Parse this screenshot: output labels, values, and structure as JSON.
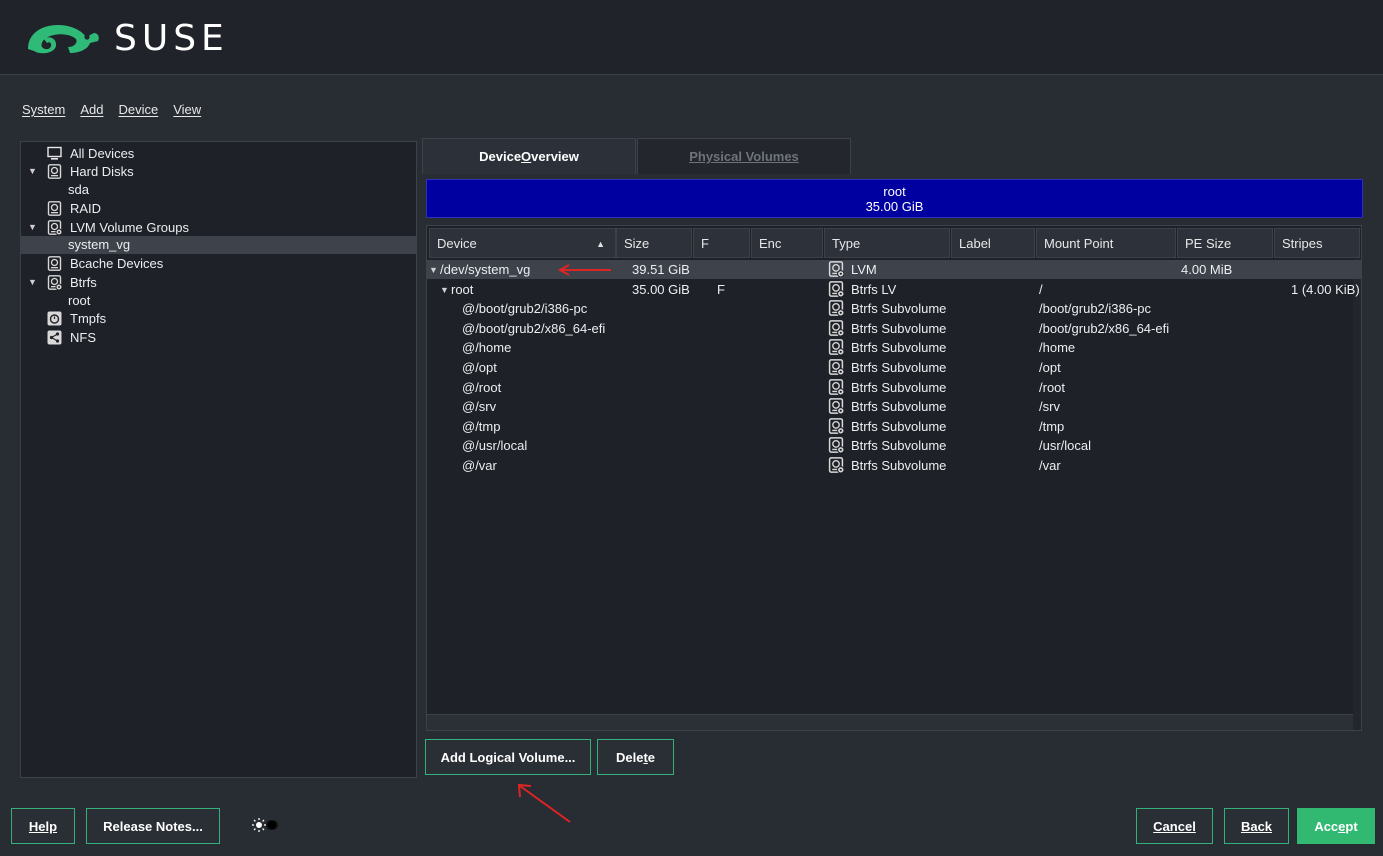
{
  "header": {
    "brand": "SUSE"
  },
  "menu": [
    {
      "label": "System",
      "name": "menu-system"
    },
    {
      "label": "Add",
      "name": "menu-add"
    },
    {
      "label": "Device",
      "name": "menu-device"
    },
    {
      "label": "View",
      "name": "menu-view"
    }
  ],
  "tree": [
    {
      "label": "All Devices",
      "icon": "monitor-icon",
      "level": 0,
      "expander": false
    },
    {
      "label": "Hard Disks",
      "icon": "hard-disk-icon",
      "level": 0,
      "expander": true
    },
    {
      "label": "sda",
      "icon": null,
      "level": 1,
      "expander": false
    },
    {
      "label": "RAID",
      "icon": "raid-icon",
      "level": 0,
      "expander": false
    },
    {
      "label": "LVM Volume Groups",
      "icon": "lvm-icon",
      "level": 0,
      "expander": true
    },
    {
      "label": "system_vg",
      "icon": null,
      "level": 1,
      "expander": false,
      "selected": true
    },
    {
      "label": "Bcache Devices",
      "icon": "bcache-icon",
      "level": 0,
      "expander": false
    },
    {
      "label": "Btrfs",
      "icon": "btrfs-icon",
      "level": 0,
      "expander": true
    },
    {
      "label": "root",
      "icon": null,
      "level": 1,
      "expander": false
    },
    {
      "label": "Tmpfs",
      "icon": "tmpfs-icon",
      "level": 0,
      "expander": false
    },
    {
      "label": "NFS",
      "icon": "nfs-icon",
      "level": 0,
      "expander": false
    }
  ],
  "tabs": {
    "overview": {
      "pre": "Device ",
      "u": "O",
      "post": "verview"
    },
    "physical": {
      "label": "Physical Volumes"
    }
  },
  "summary": {
    "name": "root",
    "size": "35.00 GiB"
  },
  "table": {
    "columns": [
      "Device",
      "Size",
      "F",
      "Enc",
      "Type",
      "Label",
      "Mount Point",
      "PE Size",
      "Stripes"
    ],
    "rows": [
      {
        "device": "/dev/system_vg",
        "indent": 0,
        "expander": true,
        "size": "39.51 GiB",
        "f": "",
        "enc": "",
        "type": "LVM",
        "type_icon": "lvm-icon",
        "label": "",
        "mount": "",
        "pe": "4.00 MiB",
        "stripes": "",
        "selected": true
      },
      {
        "device": "root",
        "indent": 1,
        "expander": true,
        "size": "35.00 GiB",
        "f": "F",
        "enc": "",
        "type": "Btrfs LV",
        "type_icon": "btrfs-lv-icon",
        "label": "",
        "mount": "/",
        "pe": "",
        "stripes": "1 (4.00 KiB)"
      },
      {
        "device": "@/boot/grub2/i386-pc",
        "indent": 2,
        "expander": false,
        "size": "",
        "f": "",
        "enc": "",
        "type": "Btrfs Subvolume",
        "type_icon": "subvolume-icon",
        "label": "",
        "mount": "/boot/grub2/i386-pc",
        "pe": "",
        "stripes": ""
      },
      {
        "device": "@/boot/grub2/x86_64-efi",
        "indent": 2,
        "expander": false,
        "size": "",
        "f": "",
        "enc": "",
        "type": "Btrfs Subvolume",
        "type_icon": "subvolume-icon",
        "label": "",
        "mount": "/boot/grub2/x86_64-efi",
        "pe": "",
        "stripes": ""
      },
      {
        "device": "@/home",
        "indent": 2,
        "expander": false,
        "size": "",
        "f": "",
        "enc": "",
        "type": "Btrfs Subvolume",
        "type_icon": "subvolume-icon",
        "label": "",
        "mount": "/home",
        "pe": "",
        "stripes": ""
      },
      {
        "device": "@/opt",
        "indent": 2,
        "expander": false,
        "size": "",
        "f": "",
        "enc": "",
        "type": "Btrfs Subvolume",
        "type_icon": "subvolume-icon",
        "label": "",
        "mount": "/opt",
        "pe": "",
        "stripes": ""
      },
      {
        "device": "@/root",
        "indent": 2,
        "expander": false,
        "size": "",
        "f": "",
        "enc": "",
        "type": "Btrfs Subvolume",
        "type_icon": "subvolume-icon",
        "label": "",
        "mount": "/root",
        "pe": "",
        "stripes": ""
      },
      {
        "device": "@/srv",
        "indent": 2,
        "expander": false,
        "size": "",
        "f": "",
        "enc": "",
        "type": "Btrfs Subvolume",
        "type_icon": "subvolume-icon",
        "label": "",
        "mount": "/srv",
        "pe": "",
        "stripes": ""
      },
      {
        "device": "@/tmp",
        "indent": 2,
        "expander": false,
        "size": "",
        "f": "",
        "enc": "",
        "type": "Btrfs Subvolume",
        "type_icon": "subvolume-icon",
        "label": "",
        "mount": "/tmp",
        "pe": "",
        "stripes": ""
      },
      {
        "device": "@/usr/local",
        "indent": 2,
        "expander": false,
        "size": "",
        "f": "",
        "enc": "",
        "type": "Btrfs Subvolume",
        "type_icon": "subvolume-icon",
        "label": "",
        "mount": "/usr/local",
        "pe": "",
        "stripes": ""
      },
      {
        "device": "@/var",
        "indent": 2,
        "expander": false,
        "size": "",
        "f": "",
        "enc": "",
        "type": "Btrfs Subvolume",
        "type_icon": "subvolume-icon",
        "label": "",
        "mount": "/var",
        "pe": "",
        "stripes": ""
      }
    ]
  },
  "actions": {
    "add_lv": "Add Logical Volume...",
    "delete": {
      "pre": "Dele",
      "u": "t",
      "post": "e"
    }
  },
  "footer": {
    "help": "Help",
    "release_notes": "Release Notes...",
    "cancel": "Cancel",
    "back": "Back",
    "accept": {
      "pre": "Acc",
      "u": "e",
      "post": "pt"
    }
  },
  "colors": {
    "accent": "#31b871",
    "summary_bg": "#0000a0",
    "annotation_red": "#e02424"
  }
}
